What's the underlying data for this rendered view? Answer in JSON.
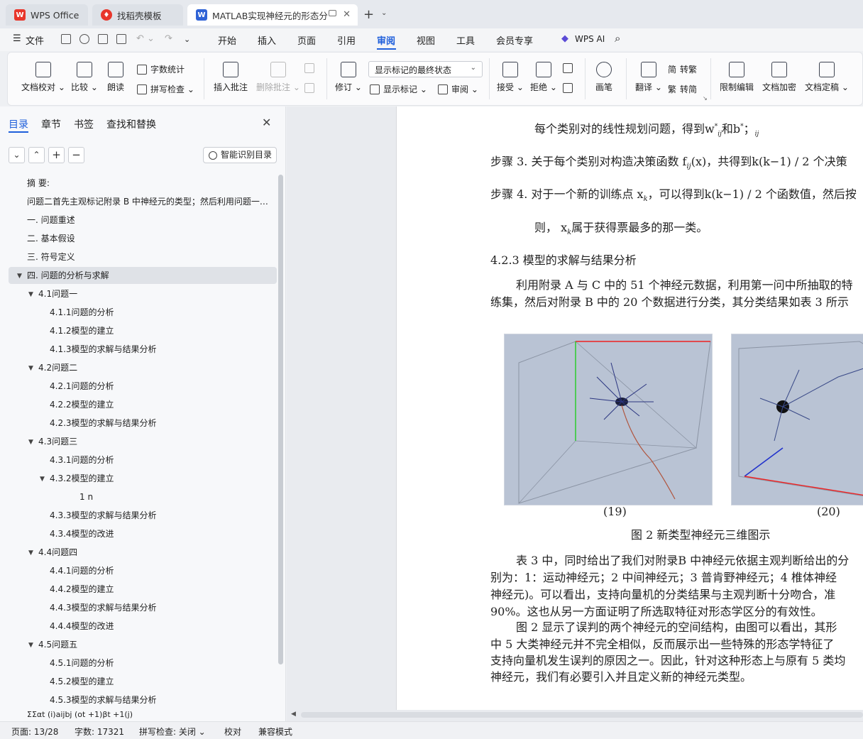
{
  "tabs": [
    {
      "label": "WPS Office"
    },
    {
      "label": "找稻壳模板"
    },
    {
      "label": "MATLAB实现神经元的形态分"
    }
  ],
  "menu": {
    "file": "文件",
    "items": [
      "开始",
      "插入",
      "页面",
      "引用",
      "审阅",
      "视图",
      "工具",
      "会员专享"
    ],
    "active": "审阅",
    "wps_ai": "WPS AI"
  },
  "ribbon": {
    "doc_check": "文档校对",
    "compare": "比较",
    "read_aloud": "朗读",
    "word_count": "字数统计",
    "spell_check": "拼写检查",
    "insert_comment": "插入批注",
    "delete_comment": "删除批注",
    "revise": "修订",
    "markup_state": "显示标记的最终状态",
    "show_markup": "显示标记",
    "review": "审阅",
    "accept": "接受",
    "reject": "拒绝",
    "pen": "画笔",
    "translate": "翻译",
    "to_traditional": "转繁",
    "to_simplified": "转简",
    "traditional_glyph": "简",
    "simplified_glyph": "繁",
    "restrict_edit": "限制编辑",
    "encrypt": "文档加密",
    "finalize": "文档定稿"
  },
  "nav": {
    "tabs": [
      "目录",
      "章节",
      "书签",
      "查找和替换"
    ],
    "smart_toc": "智能识别目录",
    "toc": [
      {
        "text": "摘  要:",
        "level": 0
      },
      {
        "text": "问题二首先主观标记附录 B 中神经元的类型；然后利用问题一中的特征参数...",
        "level": 0
      },
      {
        "text": "一.   问题重述",
        "level": 0
      },
      {
        "text": "二.   基本假设",
        "level": 0
      },
      {
        "text": "三.   符号定义",
        "level": 0
      },
      {
        "text": "四.   问题的分析与求解",
        "level": 0
      },
      {
        "text": "4.1问题一",
        "level": 1
      },
      {
        "text": "4.1.1问题的分析",
        "level": 2
      },
      {
        "text": "4.1.2模型的建立",
        "level": 2
      },
      {
        "text": "4.1.3模型的求解与结果分析",
        "level": 2
      },
      {
        "text": "4.2问题二",
        "level": 1
      },
      {
        "text": "4.2.1问题的分析",
        "level": 2
      },
      {
        "text": "4.2.2模型的建立",
        "level": 2
      },
      {
        "text": "4.2.3模型的求解与结果分析",
        "level": 2
      },
      {
        "text": "4.3问题三",
        "level": 1
      },
      {
        "text": "4.3.1问题的分析",
        "level": 2
      },
      {
        "text": "4.3.2模型的建立",
        "level": 2
      },
      {
        "text": "1   n",
        "level": 3
      },
      {
        "text": "4.3.3模型的求解与结果分析",
        "level": 2
      },
      {
        "text": "4.3.4模型的改进",
        "level": 2
      },
      {
        "text": "4.4问题四",
        "level": 1
      },
      {
        "text": "4.4.1问题的分析",
        "level": 2
      },
      {
        "text": "4.4.2模型的建立",
        "level": 2
      },
      {
        "text": "4.4.3模型的求解与结果分析",
        "level": 2
      },
      {
        "text": "4.4.4模型的改进",
        "level": 2
      },
      {
        "text": "4.5问题五",
        "level": 1
      },
      {
        "text": "4.5.1问题的分析",
        "level": 2
      },
      {
        "text": "4.5.2模型的建立",
        "level": 2
      },
      {
        "text": "4.5.3模型的求解与结果分析",
        "level": 2
      },
      {
        "text": "ΣΣαt (i)aijbj (ot +1)βt +1(j)",
        "level": 0
      }
    ]
  },
  "doc": {
    "lines": [
      "每个类别对的线性规划问题，得到w",
      "和b",
      "；",
      "步骤 3. 关于每个类别对构造决策函数 f",
      "(x)，共得到k(k−1) / 2 个决策",
      "步骤 4. 对于一个新的训练点 x",
      "，可以得到k(k−1) / 2 个函数值，然后按",
      "则，  x",
      "属于获得票最多的那一类。",
      "4.2.3  模型的求解与结果分析",
      "利用附录 A 与 C 中的 51 个神经元数据，利用第一问中所抽取的特",
      "练集，然后对附录 B 中的 20 个数据进行分类，其分类结果如表 3 所示",
      "(19)",
      "(20)",
      "图 2  新类型神经元三维图示",
      "表 3 中，同时给出了我们对附录B 中神经元依据主观判断给出的分",
      "别为：1：运动神经元；2 中间神经元；3 普肯野神经元；4 椎体神经",
      "神经元)。可以看出，支持向量机的分类结果与主观判断十分吻合，准",
      "90%。这也从另一方面证明了所选取特征对形态学区分的有效性。",
      "图 2 显示了误判的两个神经元的空间结构，由图可以看出，其形",
      "中 5 大类神经元并不完全相似，反而展示出一些特殊的形态学特征了",
      "支持向量机发生误判的原因之一。因此，针对这种形态上与原有 5 类均",
      "神经元，我们有必要引入并且定义新的神经元类型。"
    ],
    "sup_star": "*",
    "sub_ij": "ij",
    "sub_k": "k"
  },
  "status": {
    "page": "页面: 13/28",
    "words": "字数: 17321",
    "spell": "拼写检查: 关闭",
    "proof": "校对",
    "compat": "兼容模式"
  },
  "colors": {
    "accent": "#1f5fdb",
    "wps_red": "#e8362b",
    "doc_blue": "#2f63d6"
  }
}
